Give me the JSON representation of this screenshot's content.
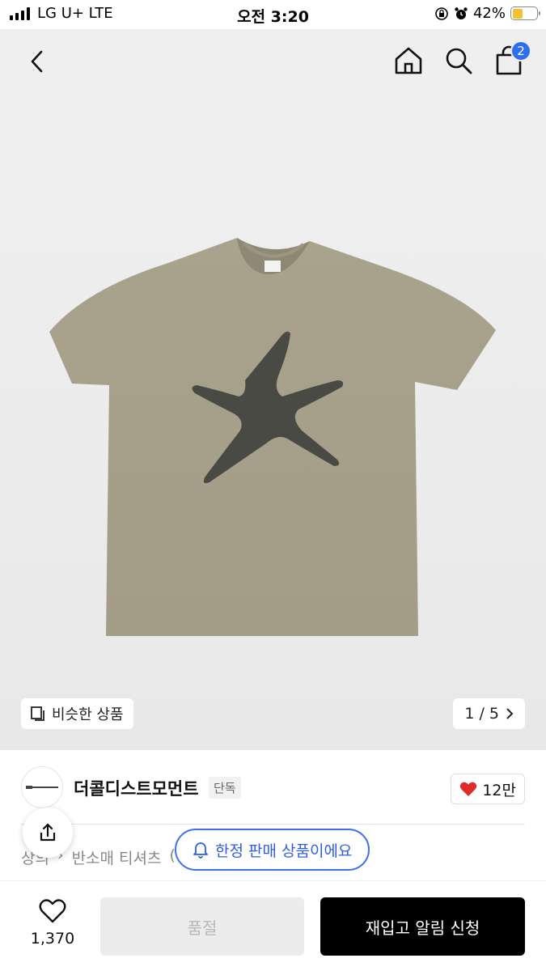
{
  "status_bar": {
    "carrier": "LG U+  LTE",
    "time": "오전 3:20",
    "battery": "42%",
    "battery_level": 0.42
  },
  "header": {
    "back_icon": "chevron-left-icon",
    "home_icon": "home-icon",
    "search_icon": "search-icon",
    "cart_icon": "shopping-bag-icon",
    "cart_count": "2",
    "badge_color": "#2e6ff2"
  },
  "gallery": {
    "similar_label": "비슷한 상품",
    "page_indicator": "1 / 5",
    "shirt_color": "#a69f8a",
    "print_color": "#4a4a44"
  },
  "brand": {
    "name": "더콜디스트모먼트",
    "tag": "단독",
    "likes": "12만"
  },
  "breadcrumb": {
    "items": [
      "상의",
      "반소매 티셔츠",
      "("
    ]
  },
  "notice": {
    "label": "한정 판매 상품이에요"
  },
  "bottom_bar": {
    "wish_count": "1,370",
    "soldout_label": "품절",
    "restock_label": "재입고 알림 신청"
  }
}
